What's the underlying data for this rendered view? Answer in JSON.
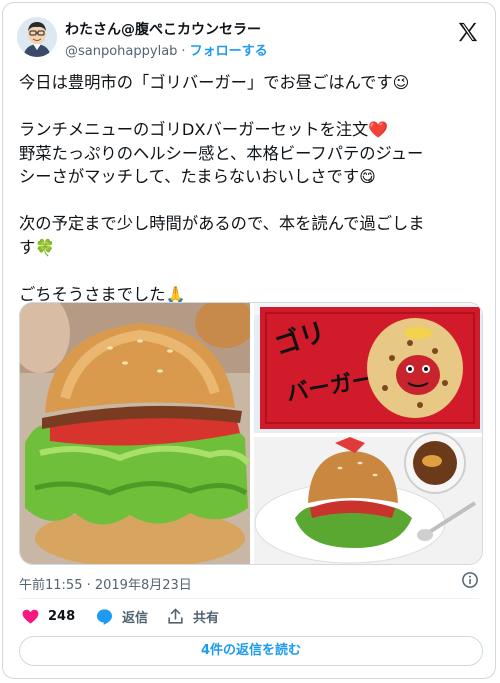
{
  "author": {
    "name": "わたさん@腹ぺこカウンセラー",
    "handle": "@sanpohappylab",
    "separator": "·",
    "follow_label": "フォローする"
  },
  "tweet": {
    "line1": "今日は豊明市の「ゴリバーガー」でお昼ごはんです",
    "line1_emoji": "😉",
    "line2": "ランチメニューのゴリDXバーガーセットを注文",
    "line2_emoji": "❤️",
    "line3": "野菜たっぷりのヘルシー感と、本格ビーフパテのジュー",
    "line4": "シーさがマッチして、たまらないおいしさです",
    "line4_emoji": "😋",
    "line5": "次の予定まで少し時間があるので、本を読んで過ごしま",
    "line6": "す",
    "line6_emoji": "🍀",
    "line7": "ごちそうさまでした",
    "line7_emoji": "🙏"
  },
  "media": {
    "sign_text_1": "ゴリ",
    "sign_text_2": "バーガー"
  },
  "meta": {
    "timestamp": "午前11:55 · 2019年8月23日"
  },
  "actions": {
    "like_count": "248",
    "reply_label": "返信",
    "share_label": "共有",
    "read_replies_label": "4件の返信を読む"
  },
  "colors": {
    "accent": "#1d9bf0",
    "like": "#f91880",
    "text": "#0f1419",
    "muted": "#536471",
    "border": "#cfd9de"
  }
}
